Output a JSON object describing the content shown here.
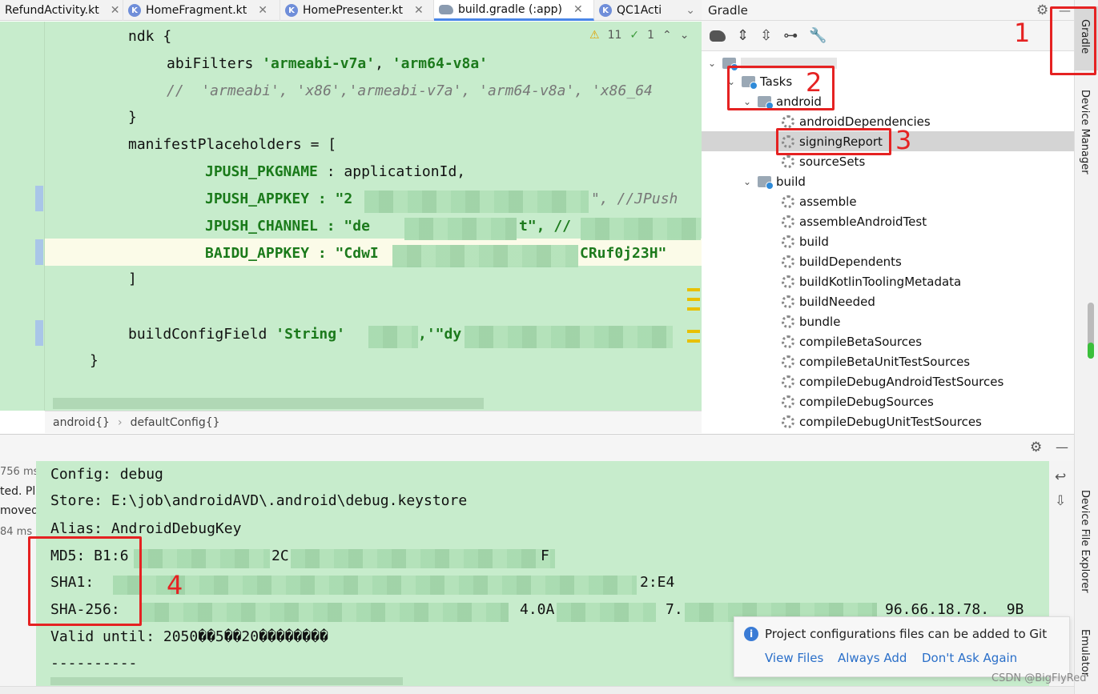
{
  "tabs": [
    {
      "label": "RefundActivity.kt",
      "icon": "kotlin-file-icon"
    },
    {
      "label": "HomeFragment.kt",
      "icon": "kotlin-file-icon"
    },
    {
      "label": "HomePresenter.kt",
      "icon": "kotlin-file-icon"
    },
    {
      "label": "build.gradle (:app)",
      "icon": "gradle-elephant-icon",
      "active": true
    },
    {
      "label": "QC1Acti",
      "icon": "kotlin-file-icon"
    }
  ],
  "editor": {
    "inspection": {
      "warnings": "11",
      "weak_warnings": "1"
    },
    "lines": {
      "l1": "ndk {",
      "l2_key": "abiFilters ",
      "l2_v1": "'armeabi-v7a'",
      "l2_sep": ", ",
      "l2_v2": "'arm64-v8a'",
      "l3": "//  'armeabi', 'x86','armeabi-v7a', 'arm64-v8a', 'x86_64",
      "l4": "}",
      "l5": "manifestPlaceholders = [",
      "l6_key": "JPUSH_PKGNAME",
      "l6_rest": " : applicationId,",
      "l7_key": "JPUSH_APPKEY",
      "l7_a": " : \"2",
      "l7_b": "\", //JPush",
      "l8_key": "JPUSH_CHANNEL",
      "l8_a": " : \"de",
      "l8_b": "t\", //",
      "l9_key": "BAIDU_APPKEY",
      "l9_a": " : \"CdwI",
      "l9_b": "CRuf0j23H\"",
      "l10": "]",
      "l11_a": "buildConfigField ",
      "l11_str": "'String'",
      "l11_b": ",'\"dy",
      "l12": "}"
    },
    "breadcrumb": [
      "android{}",
      "defaultConfig{}"
    ]
  },
  "gradle": {
    "title": "Gradle",
    "tree": {
      "tasks": "Tasks",
      "android": "android",
      "android_items": [
        "androidDependencies",
        "signingReport",
        "sourceSets"
      ],
      "build": "build",
      "build_items": [
        "assemble",
        "assembleAndroidTest",
        "build",
        "buildDependents",
        "buildKotlinToolingMetadata",
        "buildNeeded",
        "bundle",
        "compileBetaSources",
        "compileBetaUnitTestSources",
        "compileDebugAndroidTestSources",
        "compileDebugSources",
        "compileDebugUnitTestSources"
      ]
    },
    "selected": "signingReport"
  },
  "right_stripe": [
    "Gradle",
    "Device Manager",
    "Device File Explorer",
    "Emulator"
  ],
  "run_panel": {
    "left_fragments": [
      "756 ms",
      "ted. Pl",
      "moved.",
      "84 ms"
    ],
    "console": [
      "Config: debug",
      "Store: E:\\job\\androidAVD\\.android\\debug.keystore",
      "Alias: AndroidDebugKey",
      "MD5: B1:6",
      "SHA1:",
      "SHA-256:",
      "Valid until: 2050��5��20��������",
      "----------"
    ],
    "console_tail": {
      "md5_mid": "2C",
      "md5_end": "F",
      "sha1_end": "2:E4",
      "sha256_mid1": "4.0A",
      "sha256_mid2": "7.",
      "sha256_end": "96.66.18.78.  9B"
    }
  },
  "notification": {
    "message": "Project configurations files can be added to Git",
    "actions": [
      "View Files",
      "Always Add",
      "Don't Ask Again"
    ]
  },
  "annotations": [
    "1",
    "2",
    "3",
    "4"
  ],
  "watermark": "CSDN @BigFlyRed",
  "colors": {
    "annotation_red": "#e52222",
    "editor_bg": "#c7eccc",
    "link": "#2a6fc9"
  }
}
